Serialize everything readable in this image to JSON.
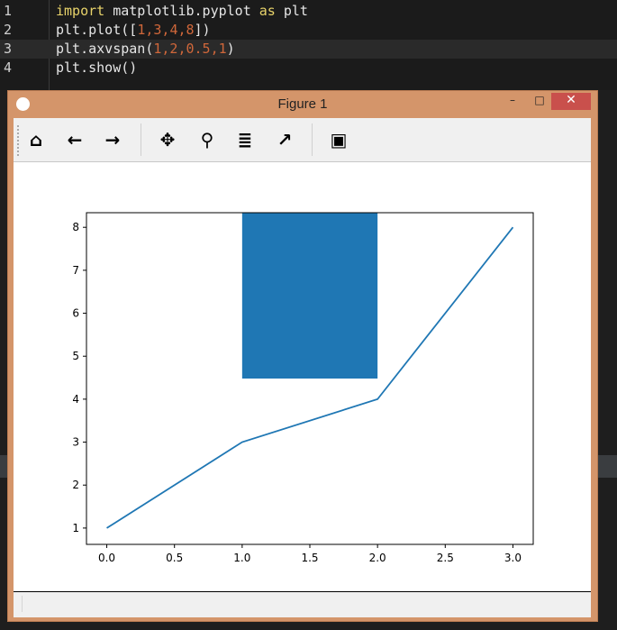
{
  "editor": {
    "lines": [
      {
        "num": "1",
        "tokens": [
          {
            "t": "import",
            "c": "kw"
          },
          {
            "t": " matplotlib.pyplot ",
            "c": ""
          },
          {
            "t": "as",
            "c": "kw"
          },
          {
            "t": " plt",
            "c": ""
          }
        ]
      },
      {
        "num": "2",
        "tokens": [
          {
            "t": "plt.plot([",
            "c": ""
          },
          {
            "t": "1",
            "c": "num"
          },
          {
            "t": ",",
            "c": "num"
          },
          {
            "t": "3",
            "c": "num"
          },
          {
            "t": ",",
            "c": "num"
          },
          {
            "t": "4",
            "c": "num"
          },
          {
            "t": ",",
            "c": "num"
          },
          {
            "t": "8",
            "c": "num"
          },
          {
            "t": "])",
            "c": ""
          }
        ]
      },
      {
        "num": "3",
        "tokens": [
          {
            "t": "plt.axvspan(",
            "c": ""
          },
          {
            "t": "1,2,0.5,1",
            "c": "num"
          },
          {
            "t": ")",
            "c": ""
          }
        ]
      },
      {
        "num": "4",
        "tokens": [
          {
            "t": "plt.show()",
            "c": ""
          }
        ]
      }
    ],
    "lightbulb_icon": "lightbulb-icon"
  },
  "window": {
    "title": "Figure 1",
    "minimize": "–",
    "maximize": "□",
    "close": "✕",
    "title_color": "#d4956a",
    "close_color": "#c9504c"
  },
  "toolbar": {
    "home": "⌂",
    "back": "←",
    "forward": "→",
    "pan": "✥",
    "zoom": "⚲",
    "configure": "≣",
    "edit": "↗",
    "save": "▣"
  },
  "chart_data": {
    "type": "line",
    "x": [
      0,
      1,
      2,
      3
    ],
    "y": [
      1,
      3,
      4,
      8
    ],
    "color": "#1f77b4",
    "axvspan": {
      "xmin": 1,
      "xmax": 2,
      "ymin_frac": 0.5,
      "ymax_frac": 1,
      "color": "#1f77b4"
    },
    "xlim": [
      -0.15,
      3.15
    ],
    "ylim": [
      0.62,
      8.34
    ],
    "xticks": [
      "0.0",
      "0.5",
      "1.0",
      "1.5",
      "2.0",
      "2.5",
      "3.0"
    ],
    "xtick_values": [
      0,
      0.5,
      1,
      1.5,
      2,
      2.5,
      3
    ],
    "yticks": [
      "1",
      "2",
      "3",
      "4",
      "5",
      "6",
      "7",
      "8"
    ],
    "ytick_values": [
      1,
      2,
      3,
      4,
      5,
      6,
      7,
      8
    ],
    "grid": false
  }
}
